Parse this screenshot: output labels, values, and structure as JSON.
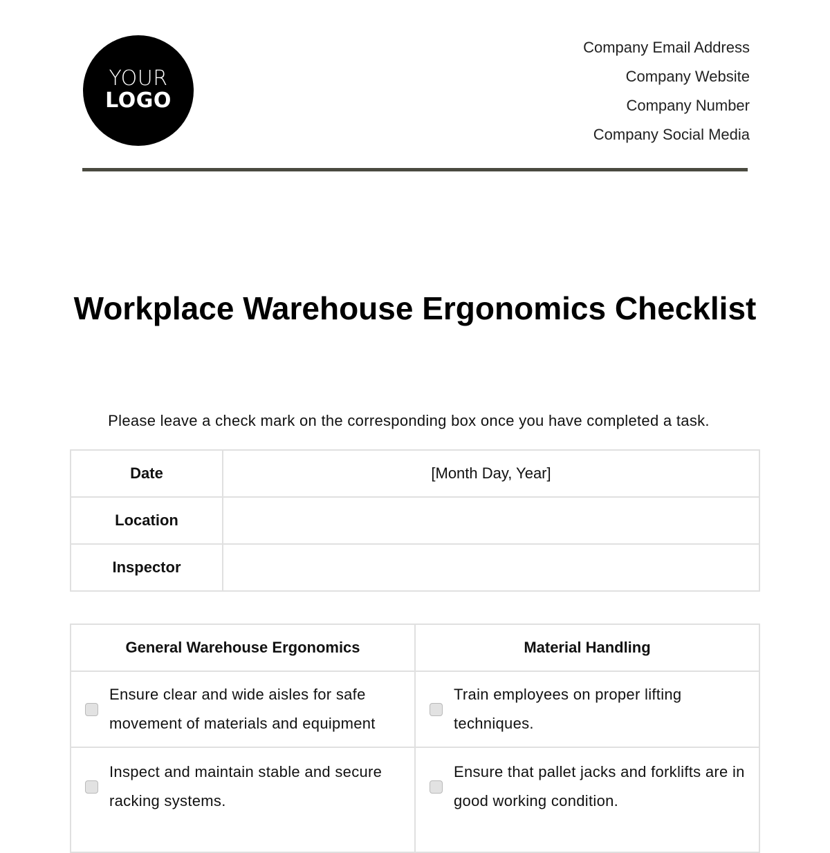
{
  "logo": {
    "line1": "YOUR",
    "line2": "LOGO"
  },
  "contact": [
    "Company Email Address",
    "Company Website",
    "Company Number",
    "Company Social Media"
  ],
  "title": "Workplace Warehouse Ergonomics Checklist",
  "instructions": "Please leave a check mark on the corresponding box once you have completed a task.",
  "info_table": [
    {
      "label": "Date",
      "value": "[Month Day, Year]"
    },
    {
      "label": "Location",
      "value": ""
    },
    {
      "label": "Inspector",
      "value": ""
    }
  ],
  "checklist": {
    "headers": [
      "General Warehouse Ergonomics",
      "Material Handling"
    ],
    "rows": [
      [
        {
          "text": "Ensure clear and wide aisles for safe movement of materials and equipment",
          "checked": false
        },
        {
          "text": "Train employees on proper lifting techniques.",
          "checked": false
        }
      ],
      [
        {
          "text": "Inspect and maintain stable and secure racking systems.",
          "checked": false
        },
        {
          "text": "Ensure that pallet jacks and forklifts are in good working condition.",
          "checked": false
        }
      ]
    ]
  }
}
